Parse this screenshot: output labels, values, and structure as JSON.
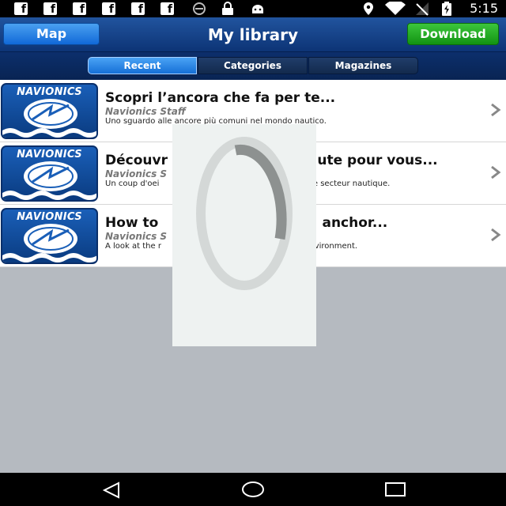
{
  "status_bar": {
    "notification_icons": [
      "facebook-icon",
      "facebook-icon",
      "facebook-icon",
      "facebook-icon",
      "facebook-icon",
      "facebook-icon",
      "sync-icon",
      "lock-icon",
      "android-icon"
    ],
    "system_icons": [
      "location-icon",
      "wifi-icon",
      "no-signal-icon",
      "battery-charging-icon"
    ],
    "time": "5:15"
  },
  "header": {
    "map_label": "Map",
    "title": "My library",
    "download_label": "Download"
  },
  "tabs": {
    "recent": "Recent",
    "categories": "Categories",
    "magazines": "Magazines",
    "selected": "Recent"
  },
  "articles": [
    {
      "thumb_brand": "NAVIONICS",
      "title": "Scopri l’ancora che fa per te...",
      "author": "Navionics Staff",
      "description": "Uno sguardo alle ancore più comuni nel mondo nautico."
    },
    {
      "thumb_brand": "NAVIONICS",
      "title": "Découvr                                ute pour vous...",
      "author": "Navionics S",
      "description": "Un coup d'oei                                          antes dans le secteur nautique."
    },
    {
      "thumb_brand": "NAVIONICS",
      "title": "How to                                   anchor...",
      "author": "Navionics S",
      "description": "A look at the r                                          e marine environment."
    }
  ],
  "navbar": {
    "icons": [
      "back-icon",
      "home-icon",
      "recents-icon"
    ]
  },
  "colors": {
    "header_blue": "#1b4b92",
    "map_button": "#2c86e6",
    "download_button": "#22a822",
    "list_background": "#b5bac0"
  }
}
